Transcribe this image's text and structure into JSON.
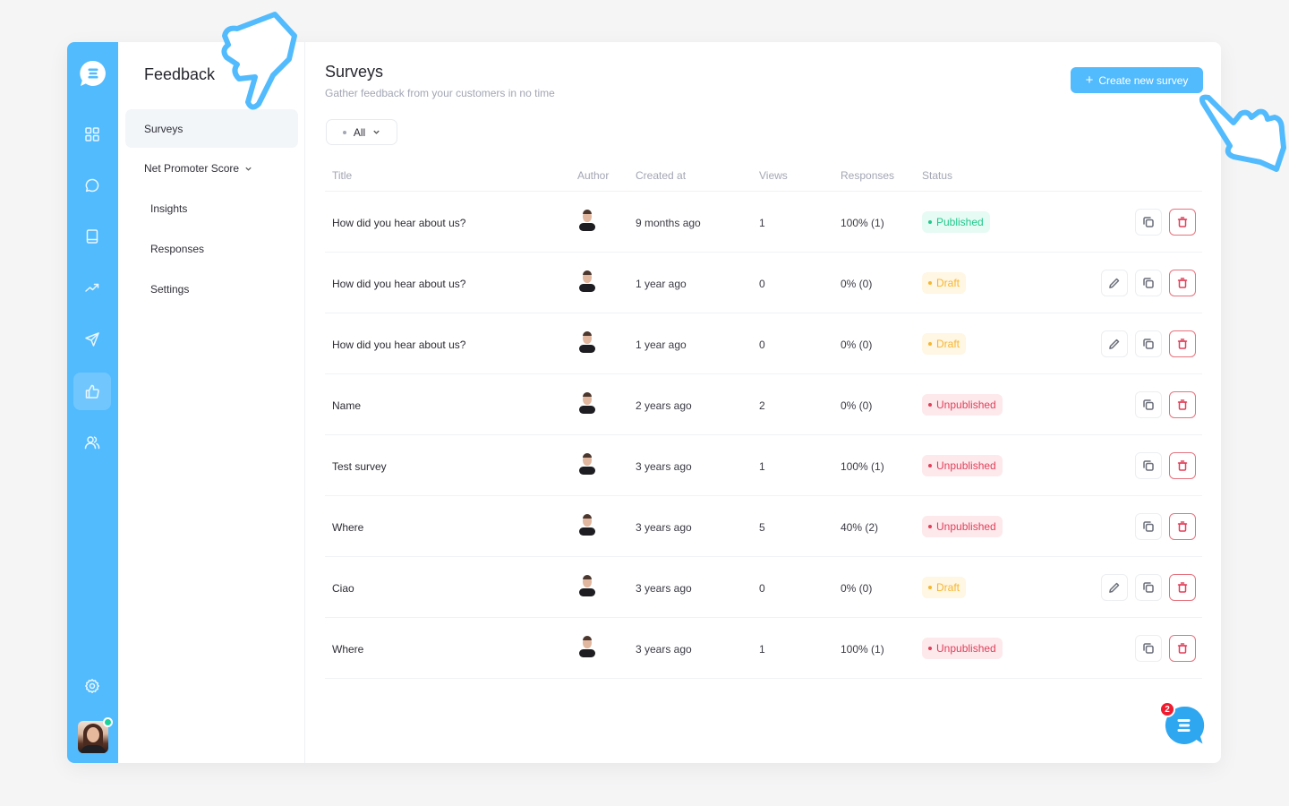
{
  "app": {
    "nav_icons": [
      {
        "name": "dashboard-icon",
        "active": false
      },
      {
        "name": "chat-icon",
        "active": false
      },
      {
        "name": "book-icon",
        "active": false
      },
      {
        "name": "trending-icon",
        "active": false
      },
      {
        "name": "send-icon",
        "active": false
      },
      {
        "name": "thumbs-up-icon",
        "active": true
      },
      {
        "name": "users-icon",
        "active": false
      },
      {
        "name": "gear-icon",
        "active": false
      }
    ],
    "colors": {
      "brand": "#52bbfd",
      "published": "#21c88e",
      "draft": "#f5b630",
      "unpublished": "#e0405a"
    }
  },
  "subnav": {
    "title": "Feedback",
    "items": [
      {
        "label": "Surveys",
        "active": true
      },
      {
        "label": "Net Promoter Score",
        "expanded": true
      },
      {
        "label": "Insights"
      },
      {
        "label": "Responses"
      },
      {
        "label": "Settings"
      }
    ]
  },
  "main": {
    "title": "Surveys",
    "subtitle": "Gather feedback from your customers in no time",
    "create_button": "Create new survey",
    "filter": {
      "selected": "All"
    },
    "columns": [
      "Title",
      "Author",
      "Created at",
      "Views",
      "Responses",
      "Status"
    ],
    "rows": [
      {
        "title": "How did you hear about us?",
        "created": "9 months ago",
        "views": "1",
        "responses": "100% (1)",
        "status": "Published",
        "status_key": "published",
        "editable": false
      },
      {
        "title": "How did you hear about us?",
        "created": "1 year ago",
        "views": "0",
        "responses": "0% (0)",
        "status": "Draft",
        "status_key": "draft",
        "editable": true
      },
      {
        "title": "How did you hear about us?",
        "created": "1 year ago",
        "views": "0",
        "responses": "0% (0)",
        "status": "Draft",
        "status_key": "draft",
        "editable": true
      },
      {
        "title": "Name",
        "created": "2 years ago",
        "views": "2",
        "responses": "0% (0)",
        "status": "Unpublished",
        "status_key": "unpublished",
        "editable": false
      },
      {
        "title": "Test survey",
        "created": "3 years ago",
        "views": "1",
        "responses": "100% (1)",
        "status": "Unpublished",
        "status_key": "unpublished",
        "editable": false
      },
      {
        "title": "Where",
        "created": "3 years ago",
        "views": "5",
        "responses": "40% (2)",
        "status": "Unpublished",
        "status_key": "unpublished",
        "editable": false
      },
      {
        "title": "Ciao",
        "created": "3 years ago",
        "views": "0",
        "responses": "0% (0)",
        "status": "Draft",
        "status_key": "draft",
        "editable": true
      },
      {
        "title": "Where",
        "created": "3 years ago",
        "views": "1",
        "responses": "100% (1)",
        "status": "Unpublished",
        "status_key": "unpublished",
        "editable": false
      }
    ]
  },
  "chat": {
    "unread_count": "2"
  }
}
